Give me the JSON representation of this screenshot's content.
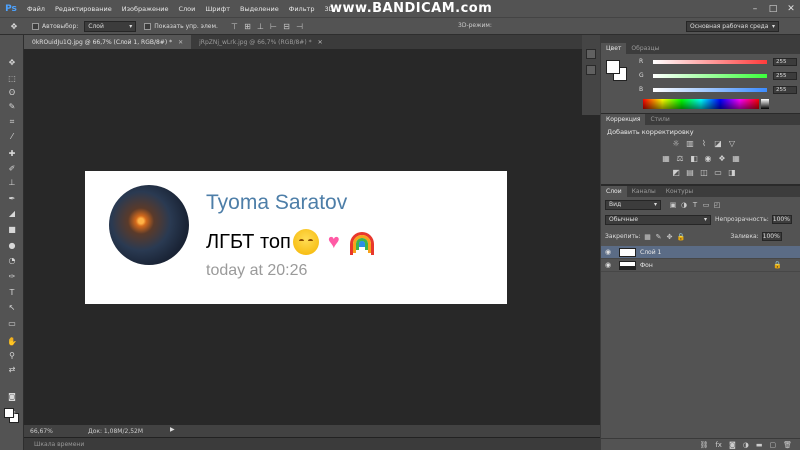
{
  "app": {
    "logo": "Ps",
    "menu": [
      "Файл",
      "Редактирование",
      "Изображение",
      "Слои",
      "Шрифт",
      "Выделение",
      "Фильтр",
      "3D"
    ],
    "watermark": "www.BANDICAM.com",
    "window_controls": [
      "–",
      "□",
      "✕"
    ]
  },
  "options_bar": {
    "autoselect_label": "Автовыбор:",
    "autoselect_value": "Слой",
    "show_controls_label": "Показать упр. элем.",
    "mode_3d": "3D-режим:",
    "workspace": "Основная рабочая среда"
  },
  "documents": {
    "tabs": [
      {
        "title": "0kROuidJu1Q.jpg @ 66,7% (Слой 1, RGB/8#) *",
        "active": true
      },
      {
        "title": "jRpZNj_wLrk.jpg @ 66,7% (RGB/8#) *",
        "active": false
      }
    ]
  },
  "message": {
    "sender": "Tyoma Saratov",
    "text": "ЛГБТ топ",
    "emojis": [
      "relieved-face",
      "two-hearts",
      "rainbow"
    ],
    "timestamp": "today at 20:26"
  },
  "status": {
    "zoom": "66,67%",
    "doc_info": "Док: 1,08M/2,52M",
    "timeline": "Шкала времени"
  },
  "color_panel": {
    "tabs": [
      "Цвет",
      "Образцы"
    ],
    "channels": [
      {
        "label": "R",
        "value": "255"
      },
      {
        "label": "G",
        "value": "255"
      },
      {
        "label": "B",
        "value": "255"
      }
    ],
    "colors": {
      "r_slider": "#ff3b3b",
      "g_slider": "#3bff3b",
      "b_slider": "#3b8bff"
    }
  },
  "adjustments_panel": {
    "tabs": [
      "Коррекция",
      "Стили"
    ],
    "title": "Добавить корректировку"
  },
  "layers_panel": {
    "tabs": [
      "Слои",
      "Каналы",
      "Контуры"
    ],
    "filter": "Вид",
    "blend_mode": "Обычные",
    "opacity_label": "Непрозрачность:",
    "opacity_value": "100%",
    "lock_label": "Закрепить:",
    "fill_label": "Заливка:",
    "fill_value": "100%",
    "layers": [
      {
        "name": "Слой 1",
        "selected": true,
        "locked": false
      },
      {
        "name": "Фон",
        "selected": false,
        "locked": true
      }
    ]
  }
}
